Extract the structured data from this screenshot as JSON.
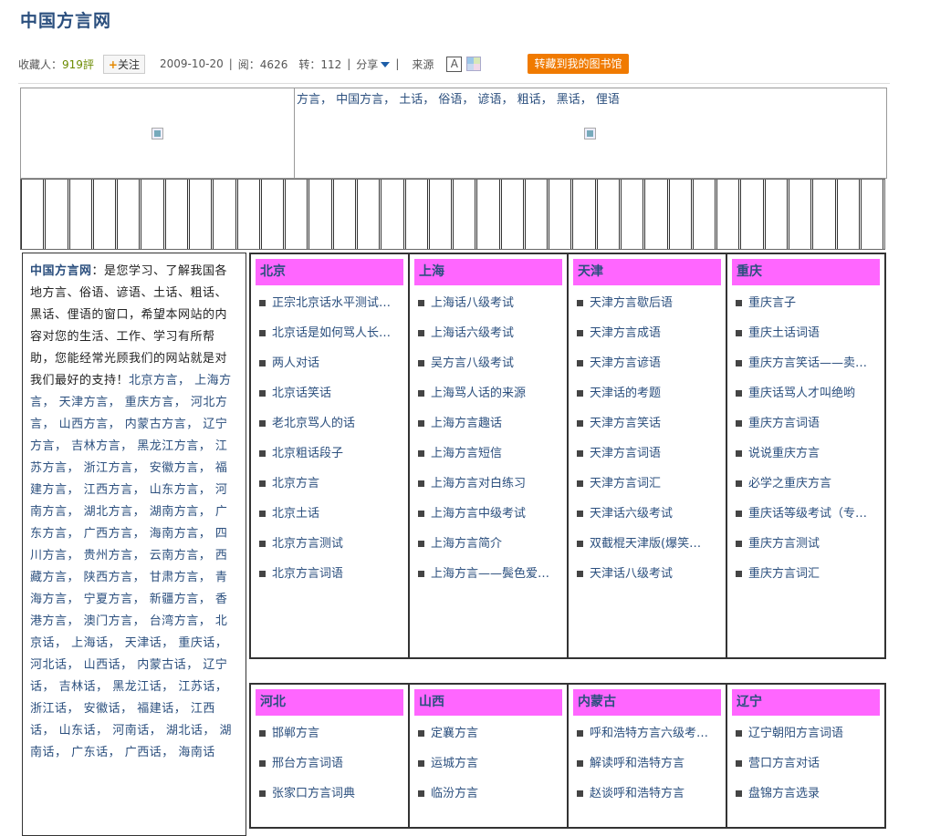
{
  "page": {
    "title": "中国方言网"
  },
  "meta": {
    "collect_label": "收藏人：",
    "collect_count": "919評",
    "follow_label": "关注",
    "date": "2009-10-20",
    "reads_label": "阅：4626",
    "reposts_label": "转：112",
    "share_label": "分享",
    "source_label": "来源",
    "font_button": "A",
    "save_button": "转藏到我的图书馆"
  },
  "banner": {
    "keywords": "方言， 中国方言， 土话， 俗语， 谚语， 粗话， 黑话， 俚语"
  },
  "intro": {
    "title": "中国方言网",
    "text": "：是您学习、了解我国各地方言、俗语、谚语、土话、粗话、黑话、俚语的窗口，希望本网站的内容对您的生活、工作、学习有所帮助，您能经常光顾我们的网站就是对我们最好的支持！",
    "links": "北京方言， 上海方言， 天津方言， 重庆方言， 河北方言， 山西方言， 内蒙古方言， 辽宁方言， 吉林方言， 黑龙江方言， 江苏方言， 浙江方言， 安徽方言， 福建方言， 江西方言， 山东方言， 河南方言， 湖北方言， 湖南方言， 广东方言， 广西方言， 海南方言， 四川方言， 贵州方言， 云南方言， 西藏方言， 陕西方言， 甘肃方言， 青海方言， 宁夏方言， 新疆方言， 香港方言， 澳门方言， 台湾方言， 北京话， 上海话， 天津话， 重庆话， 河北话， 山西话， 内蒙古话， 辽宁话， 吉林话， 黑龙江话， 江苏话， 浙江话， 安徽话， 福建话， 江西话， 山东话， 河南话， 湖北话， 湖南话， 广东话， 广西话， 海南话"
  },
  "section1": [
    {
      "name": "北京",
      "items": [
        "正宗北京话水平测试…",
        "北京话是如何骂人长…",
        "两人对话",
        "北京话笑话",
        "老北京骂人的话",
        "北京粗话段子",
        "北京方言",
        "北京土话",
        "北京方言测试",
        "北京方言词语"
      ]
    },
    {
      "name": "上海",
      "items": [
        "上海话八级考试",
        "上海话六级考试",
        "吴方言八级考试",
        "上海骂人话的来源",
        "上海方言趣话",
        "上海方言短信",
        "上海方言对白练习",
        "上海方言中级考试",
        "上海方言简介",
        "上海方言——鬓色爱…"
      ]
    },
    {
      "name": "天津",
      "items": [
        "天津方言歇后语",
        "天津方言成语",
        "天津方言谚语",
        "天津话的考题",
        "天津方言笑话",
        "天津方言词语",
        "天津方言词汇",
        "天津话六级考试",
        "双截棍天津版(爆笑…",
        "天津话八级考试"
      ]
    },
    {
      "name": "重庆",
      "items": [
        "重庆言子",
        "重庆土话词语",
        "重庆方言笑话——卖…",
        "重庆话骂人才叫绝哟",
        "重庆方言词语",
        "说说重庆方言",
        "必学之重庆方言",
        "重庆话等级考试（专…",
        "重庆方言测试",
        "重庆方言词汇"
      ]
    }
  ],
  "section2": [
    {
      "name": "河北",
      "items": [
        "邯郸方言",
        "邢台方言词语",
        "张家口方言词典"
      ]
    },
    {
      "name": "山西",
      "items": [
        "定襄方言",
        "运城方言",
        "临汾方言"
      ]
    },
    {
      "name": "内蒙古",
      "items": [
        "呼和浩特方言六级考…",
        "解读呼和浩特方言",
        "赵谈呼和浩特方言"
      ]
    },
    {
      "name": "辽宁",
      "items": [
        "辽宁朝阳方言词语",
        "营口方言对话",
        "盘锦方言选录"
      ]
    }
  ]
}
